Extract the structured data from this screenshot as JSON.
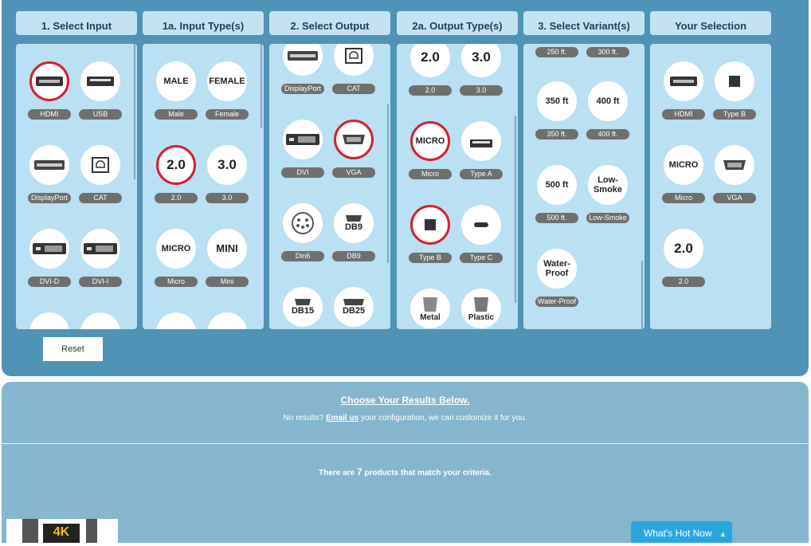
{
  "columns": [
    {
      "title": "1. Select Input",
      "items": [
        {
          "label": "HDMI",
          "icon": "hdmi-icon",
          "selected": true
        },
        {
          "label": "USB",
          "icon": "usb-icon"
        },
        {
          "label": "DisplayPort",
          "icon": "displayport-icon"
        },
        {
          "label": "CAT",
          "icon": "cat-icon"
        },
        {
          "label": "DVI-D",
          "icon": "dvi-icon"
        },
        {
          "label": "DVI-I",
          "icon": "dvi-icon"
        }
      ]
    },
    {
      "title": "1a. Input Type(s)",
      "items": [
        {
          "label": "Male",
          "text": "MALE"
        },
        {
          "label": "Female",
          "text": "FEMALE"
        },
        {
          "label": "2.0",
          "text": "2.0",
          "selected": true,
          "big": true
        },
        {
          "label": "3.0",
          "text": "3.0",
          "big": true
        },
        {
          "label": "Micro",
          "text": "MICRO"
        },
        {
          "label": "Mini",
          "text": "MINI"
        }
      ]
    },
    {
      "title": "2. Select Output",
      "items": [
        {
          "label": "DisplayPort",
          "icon": "displayport-icon"
        },
        {
          "label": "CAT",
          "icon": "cat-icon"
        },
        {
          "label": "DVI",
          "icon": "dvi-icon"
        },
        {
          "label": "VGA",
          "icon": "vga-icon",
          "selected": true
        },
        {
          "label": "Din6",
          "icon": "din6-icon"
        },
        {
          "label": "DB9",
          "icon": "db9-icon",
          "text": "DB9"
        },
        {
          "text": "DB15",
          "icon": "db15-icon"
        },
        {
          "text": "DB25",
          "icon": "db25-icon"
        }
      ]
    },
    {
      "title": "2a. Output Type(s)",
      "items": [
        {
          "label": "2.0",
          "text": "2.0",
          "big": true
        },
        {
          "label": "3.0",
          "text": "3.0",
          "big": true
        },
        {
          "label": "Micro",
          "text": "MICRO",
          "selected": true
        },
        {
          "label": "Type A",
          "icon": "usb-type-a-icon"
        },
        {
          "label": "Type B",
          "icon": "usb-type-b-icon",
          "selected": true
        },
        {
          "label": "Type C",
          "icon": "usb-type-c-icon"
        },
        {
          "text": "Metal",
          "icon": "metal-hood-icon"
        },
        {
          "text": "Plastic",
          "icon": "plastic-hood-icon"
        }
      ]
    },
    {
      "title": "3. Select Variant(s)",
      "items": [
        {
          "label": "250 ft."
        },
        {
          "label": "300 ft."
        },
        {
          "label": "350 ft.",
          "text": "350 ft"
        },
        {
          "label": "400 ft.",
          "text": "400 ft"
        },
        {
          "label": "500 ft.",
          "text": "500 ft"
        },
        {
          "label": "Low-Smoke",
          "text": "Low-Smoke"
        },
        {
          "label": "Water-Proof",
          "text": "Water-Proof"
        }
      ]
    },
    {
      "title": "Your Selection",
      "items": [
        {
          "label": "HDMI",
          "icon": "hdmi-icon"
        },
        {
          "label": "Type B",
          "icon": "usb-type-b-icon"
        },
        {
          "label": "Micro",
          "text": "MICRO"
        },
        {
          "label": "VGA",
          "icon": "vga-icon"
        },
        {
          "label": "2.0",
          "text": "2.0",
          "big": true
        }
      ]
    }
  ],
  "reset_label": "Reset",
  "results": {
    "heading": "Choose Your Results Below.",
    "sub_prefix": "No results? ",
    "sub_link": "Email us",
    "sub_suffix": " your configuration, we can customize it for you.",
    "count_prefix": "There are ",
    "count": "7",
    "count_suffix": " products that match your criteria."
  },
  "thumb_text": "4K",
  "whats_hot": "What's Hot Now",
  "colors": {
    "selected_ring": "#d81f2a",
    "panel": "#4f93b6",
    "tile": "#b9e0f3"
  }
}
